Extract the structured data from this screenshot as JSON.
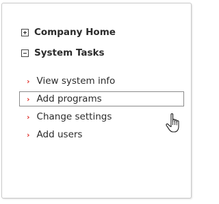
{
  "tree": {
    "sections": [
      {
        "label": "Company Home",
        "state": "collapsed",
        "toggle_icon": "plus-icon"
      },
      {
        "label": "System Tasks",
        "state": "expanded",
        "toggle_icon": "minus-icon"
      }
    ],
    "tasks": [
      {
        "label": "View system info",
        "icon": "chevron-right-icon"
      },
      {
        "label": "Add programs",
        "icon": "chevron-right-icon",
        "highlighted": true
      },
      {
        "label": "Change settings",
        "icon": "chevron-right-icon"
      },
      {
        "label": "Add users",
        "icon": "chevron-right-icon"
      }
    ]
  },
  "colors": {
    "arrow": "#e0302a",
    "text": "#2b2b2b",
    "border": "#c8c8c8",
    "highlight_border": "#8a8a8a"
  },
  "cursor": {
    "icon": "hand-pointer-icon"
  }
}
